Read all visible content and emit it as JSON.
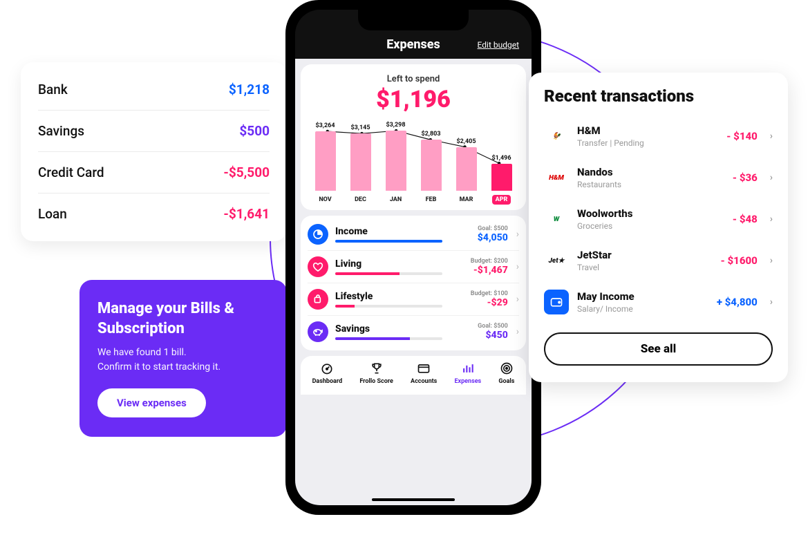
{
  "accounts": [
    {
      "label": "Bank",
      "value": "$1,218",
      "color": "c-blue"
    },
    {
      "label": "Savings",
      "value": "$500",
      "color": "c-purple"
    },
    {
      "label": "Credit Card",
      "value": "-$5,500",
      "color": "c-pink"
    },
    {
      "label": "Loan",
      "value": "-$1,641",
      "color": "c-pink"
    }
  ],
  "promo": {
    "title": "Manage your Bills & Subscription",
    "line1": "We have found 1 bill.",
    "line2": "Confirm it to start tracking it.",
    "button": "View expenses"
  },
  "phone": {
    "title": "Expenses",
    "edit": "Edit budget",
    "spend": {
      "label": "Left to spend",
      "amount": "$1,196"
    },
    "tabs": [
      {
        "label": "Dashboard",
        "icon": "gauge-icon",
        "active": false
      },
      {
        "label": "Frollo Score",
        "icon": "trophy-icon",
        "active": false
      },
      {
        "label": "Accounts",
        "icon": "card-icon",
        "active": false
      },
      {
        "label": "Expenses",
        "icon": "bars-icon",
        "active": true
      },
      {
        "label": "Goals",
        "icon": "target-icon",
        "active": false
      }
    ],
    "categories": [
      {
        "name": "Income",
        "goal": "Goal: $500",
        "amount": "$4,050",
        "color": "#0b63ff",
        "fill": 100
      },
      {
        "name": "Living",
        "goal": "Budget: $200",
        "amount": "-$1,467",
        "color": "#ff1b6b",
        "fill": 60
      },
      {
        "name": "Lifestyle",
        "goal": "Budget: $100",
        "amount": "-$29",
        "color": "#ff1b6b",
        "fill": 18
      },
      {
        "name": "Savings",
        "goal": "Goal: $500",
        "amount": "$450",
        "color": "#6b2cf5",
        "fill": 70
      }
    ]
  },
  "chart_data": {
    "type": "bar",
    "title": "Left to spend",
    "categories": [
      "NOV",
      "DEC",
      "JAN",
      "FEB",
      "MAR",
      "APR"
    ],
    "values": [
      3264,
      3145,
      3298,
      2803,
      2405,
      1496
    ],
    "value_labels": [
      "$3,264",
      "$3,145",
      "$3,298",
      "$2,803",
      "$2,405",
      "$1,496"
    ],
    "ylim": [
      0,
      3500
    ],
    "active_index": 5,
    "line_overlay": true
  },
  "transactions": {
    "title": "Recent transactions",
    "see_all": "See all",
    "items": [
      {
        "name": "H&M",
        "sub": "Transfer | Pending",
        "amount": "- $140",
        "amt_color": "#ff1b6b",
        "icon_bg": "#fff",
        "icon_text": "🐓",
        "icon_color": "#c00"
      },
      {
        "name": "Nandos",
        "sub": "Restaurants",
        "amount": "- $36",
        "amt_color": "#ff1b6b",
        "icon_bg": "#fff",
        "icon_text": "H&M",
        "icon_color": "#d00"
      },
      {
        "name": "Woolworths",
        "sub": "Groceries",
        "amount": "- $48",
        "amt_color": "#ff1b6b",
        "icon_bg": "#fff",
        "icon_text": "W",
        "icon_color": "#0a8a3a"
      },
      {
        "name": "JetStar",
        "sub": "Travel",
        "amount": "- $1600",
        "amt_color": "#ff1b6b",
        "icon_bg": "#fff",
        "icon_text": "Jet★",
        "icon_color": "#111"
      },
      {
        "name": "May Income",
        "sub": "Salary/ Income",
        "amount": "+ $4,800",
        "amt_color": "#0b63ff",
        "icon_bg": "#0b63ff",
        "icon_text": "",
        "icon_color": "#fff",
        "icon_svg": "wallet"
      }
    ]
  }
}
